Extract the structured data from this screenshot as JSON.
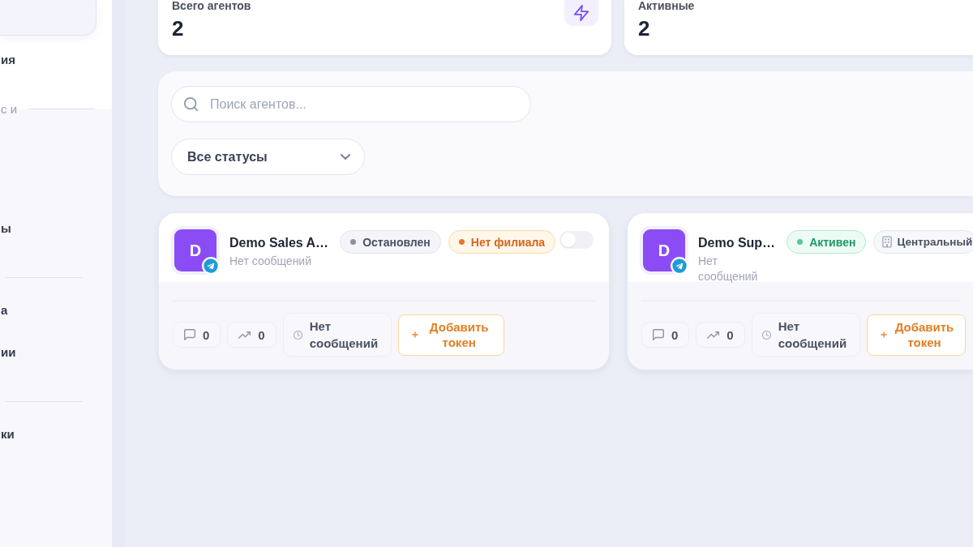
{
  "sidebar": {
    "items": [
      {
        "kind": "item",
        "selected": true
      },
      {
        "kind": "item",
        "label": "ия",
        "selected": false
      },
      {
        "kind": "section",
        "label": "с и"
      },
      {
        "kind": "item",
        "label": "ы",
        "selected": false
      },
      {
        "kind": "divider"
      },
      {
        "kind": "item",
        "label": "а",
        "selected": false
      },
      {
        "kind": "item",
        "label": "ии",
        "selected": false
      },
      {
        "kind": "divider"
      },
      {
        "kind": "item",
        "label": "ки",
        "selected": false
      }
    ]
  },
  "stats": [
    {
      "kind": "total",
      "label": "Всего агентов",
      "value": "2"
    },
    {
      "kind": "active",
      "label": "Активные",
      "value": "2"
    }
  ],
  "filters": {
    "search": {
      "placeholder": "Поиск агентов..."
    },
    "status_select": {
      "value": "Все статусы"
    }
  },
  "agents": [
    {
      "name": "Demo Sales A…",
      "avatar_letter": "D",
      "subtitle": "Нет сообщений",
      "status": {
        "kind": "stopped",
        "label": "Остановлен"
      },
      "branch": {
        "kind": "none",
        "label": "Нет филиала"
      },
      "enabled": false,
      "messages": "0",
      "trend": "0",
      "last_message": "Нет сообщений",
      "token_button": "Добавить токен"
    },
    {
      "name": "Demo Sup…",
      "avatar_letter": "D",
      "subtitle": "Нет сообщений",
      "status": {
        "kind": "active",
        "label": "Активен"
      },
      "branch": {
        "kind": "assigned",
        "label": "Центральный"
      },
      "messages": "0",
      "trend": "0",
      "last_message": "Нет сообщений",
      "token_button": "Добавить токен"
    }
  ]
}
